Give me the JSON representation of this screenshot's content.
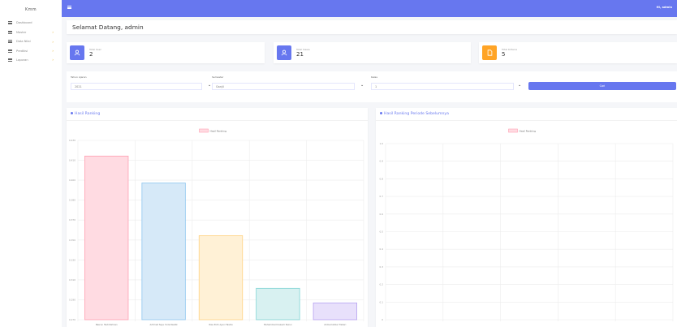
{
  "sidebar": {
    "brand": "Kmm",
    "items": [
      {
        "label": "Dashboard",
        "has_arrow": false
      },
      {
        "label": "Master",
        "has_arrow": true
      },
      {
        "label": "Data Nilai",
        "has_arrow": true
      },
      {
        "label": "Prediksi",
        "has_arrow": true
      },
      {
        "label": "Laporan",
        "has_arrow": true
      }
    ]
  },
  "topbar": {
    "user": "Hi, admin"
  },
  "header": {
    "title": "Selamat Datang, admin"
  },
  "stats": [
    {
      "label": "Total User",
      "value": "2",
      "icon": "user-icon",
      "color": "#6777ef"
    },
    {
      "label": "Total Siswa",
      "value": "21",
      "icon": "user-icon",
      "color": "#6777ef"
    },
    {
      "label": "Total Kriteria",
      "value": "5",
      "icon": "file-icon",
      "color": "#ffa426"
    }
  ],
  "filters": {
    "tahun": {
      "label": "Tahun Ajaran",
      "value": "2021"
    },
    "semester": {
      "label": "Semester",
      "value": "Ganjil"
    },
    "kelas": {
      "label": "Kelas",
      "value": "1"
    },
    "button": "Cari"
  },
  "chart_left_title": "Hasil Ranking",
  "chart_right_title": "Hasil Ranking Periode Sebelumnya",
  "chart_data": [
    {
      "type": "bar",
      "title": "Hasil Ranking",
      "legend": "Hasil Ranking",
      "categories": [
        "Nasrun Hadi Nahnan",
        "Achmad Sayu Yuda Rasdik",
        "Risa Putri Ayuni Tasdia",
        "Muhammad Caisum Nurun",
        "Ahmad Akbar Tisbari"
      ],
      "values": [
        0.416,
        0.392,
        0.345,
        0.298,
        0.285
      ],
      "ylim": [
        0.27,
        0.43
      ],
      "yticks": [
        "0.430",
        "0.410",
        "0.400",
        "0.380",
        "0.370",
        "0.350",
        "0.330",
        "0.310",
        "0.290",
        "0.270"
      ],
      "colors": [
        "#ffdbe2",
        "#d6e9f8",
        "#fff1d6",
        "#d8f1f1",
        "#e8e0fb"
      ],
      "border_colors": [
        "#ff9fb2",
        "#8fc6ef",
        "#ffd180",
        "#7fd3d3",
        "#b7a2f0"
      ]
    },
    {
      "type": "bar",
      "title": "Hasil Ranking Periode Sebelumnya",
      "legend": "Hasil Ranking",
      "categories": [],
      "values": [],
      "yticks": [
        "1.0",
        "0.9",
        "0.8",
        "0.7",
        "0.6",
        "0.5",
        "0.4",
        "0.3",
        "0.2",
        "0.1",
        "0"
      ],
      "colors": [
        "#ffdbe2"
      ],
      "border_colors": [
        "#ff9fb2"
      ]
    }
  ]
}
